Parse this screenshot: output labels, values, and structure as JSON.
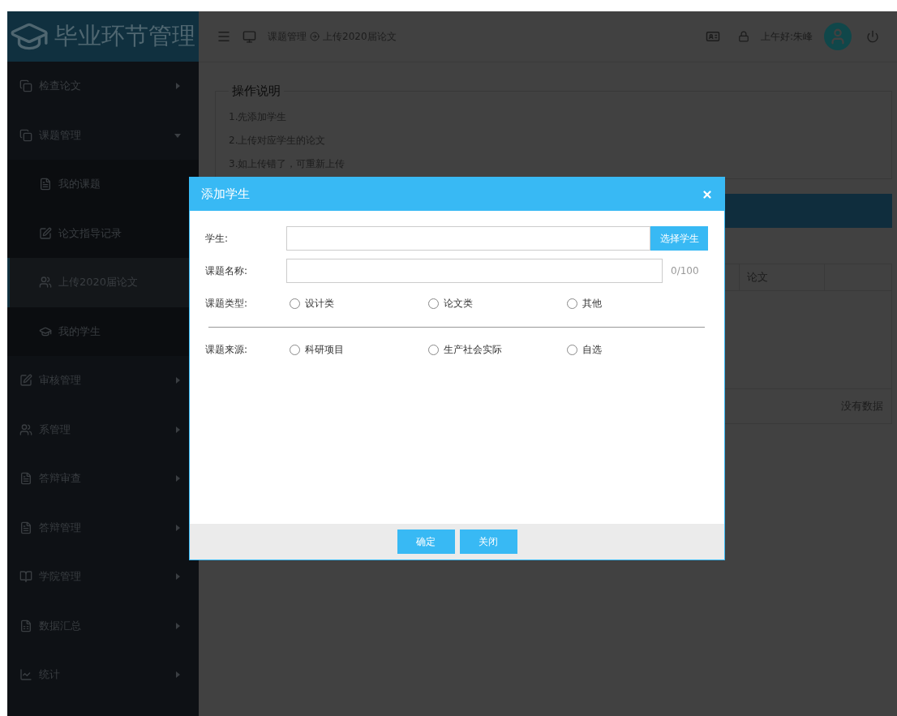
{
  "logo": {
    "title": "毕业环节管理"
  },
  "header": {
    "breadcrumb": [
      "课题管理",
      "上传2020届论文"
    ],
    "greeting": "上午好:朱峰"
  },
  "sidebar": {
    "items": [
      {
        "label": "检查论文",
        "expanded": false
      },
      {
        "label": "课题管理",
        "expanded": true,
        "children": [
          {
            "label": "我的课题",
            "selected": false
          },
          {
            "label": "论文指导记录",
            "selected": false
          },
          {
            "label": "上传2020届论文",
            "selected": true
          },
          {
            "label": "我的学生",
            "selected": false
          }
        ]
      },
      {
        "label": "审核管理",
        "expanded": false
      },
      {
        "label": "系管理",
        "expanded": false
      },
      {
        "label": "答辩审查",
        "expanded": false
      },
      {
        "label": "答辩管理",
        "expanded": false
      },
      {
        "label": "学院管理",
        "expanded": false
      },
      {
        "label": "数据汇总",
        "expanded": false
      },
      {
        "label": "统计",
        "expanded": false
      }
    ]
  },
  "instructions": {
    "title": "操作说明",
    "lines": [
      "1.先添加学生",
      "2.上传对应学生的论文",
      "3.如上传错了，可重新上传"
    ]
  },
  "table": {
    "columns": [
      "论文"
    ],
    "empty_text": "没有数据"
  },
  "dialog": {
    "title": "添加学生",
    "fields": [
      {
        "kind": "picker",
        "label": "学生:",
        "button": "选择学生"
      },
      {
        "kind": "text",
        "label": "课题名称:",
        "counter": "0/100"
      },
      {
        "kind": "radio",
        "label": "课题类型:",
        "options": [
          {
            "label": "设计类",
            "selected": false
          },
          {
            "label": "论文类",
            "selected": false
          },
          {
            "label": "其他",
            "selected": false
          }
        ]
      },
      {
        "kind": "radio",
        "label": "课题来源:",
        "options": [
          {
            "label": "科研项目",
            "selected": false
          },
          {
            "label": "生产社会实际",
            "selected": false
          },
          {
            "label": "自选",
            "selected": false
          }
        ]
      }
    ],
    "buttons": [
      "确定",
      "关闭"
    ]
  }
}
